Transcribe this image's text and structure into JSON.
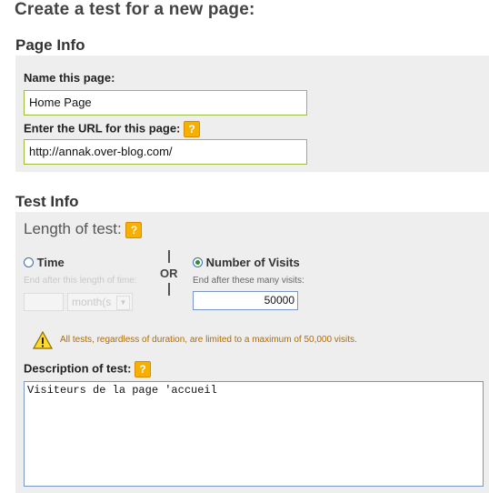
{
  "page_title": "Create a test for a new page:",
  "page_info": {
    "section_title": "Page Info",
    "name_label": "Name this page:",
    "name_value": "Home Page",
    "url_label": "Enter the URL for this page:",
    "url_value": "http://annak.over-blog.com/",
    "help_glyph": "?"
  },
  "test_info": {
    "section_title": "Test Info",
    "length_title": "Length of test:",
    "time_option": "Time",
    "time_hint": "End after this length of time:",
    "time_value": "",
    "time_unit": "month(s",
    "or_text": "OR",
    "visits_option": "Number of Visits",
    "visits_hint": "End after these many visits:",
    "visits_value": "50000",
    "selected_option": "Number of Visits",
    "warning": "All tests, regardless of duration, are limited to a maximum of 50,000 visits.",
    "description_label": "Description of test:",
    "description_value": "Visiteurs de la page 'accueil"
  },
  "colors": {
    "accent_border": "#9cba3e",
    "help_icon": "#f7b000",
    "warning_text": "#b36b00",
    "panel_bg": "#eeeeee"
  }
}
